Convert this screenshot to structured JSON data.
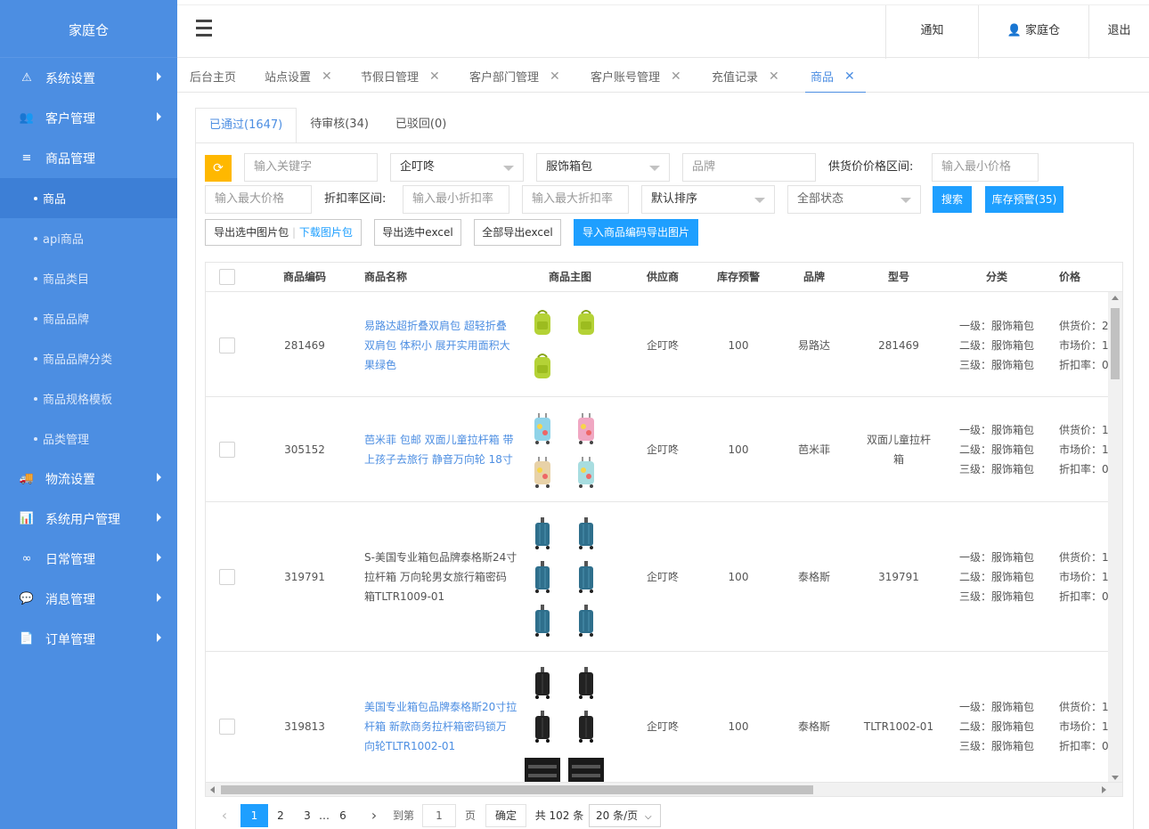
{
  "sidebar": {
    "brand": "家庭仓",
    "menu": [
      {
        "label": "系统设置",
        "icon": "warning-icon",
        "glyph": "⚠"
      },
      {
        "label": "客户管理",
        "icon": "users-icon",
        "glyph": "👥"
      },
      {
        "label": "商品管理",
        "icon": "list-icon",
        "glyph": "≡"
      },
      {
        "label": "物流设置",
        "icon": "truck-icon",
        "glyph": "🚚"
      },
      {
        "label": "系统用户管理",
        "icon": "bar-chart-icon",
        "glyph": "📊"
      },
      {
        "label": "日常管理",
        "icon": "binoculars-icon",
        "glyph": "∞"
      },
      {
        "label": "消息管理",
        "icon": "chat-icon",
        "glyph": "💬"
      },
      {
        "label": "订单管理",
        "icon": "document-icon",
        "glyph": "📄"
      }
    ],
    "submenu": [
      "商品",
      "api商品",
      "商品类目",
      "商品品牌",
      "商品品牌分类",
      "商品规格模板",
      "品类管理"
    ]
  },
  "topbar": {
    "notify": "通知",
    "user": "家庭仓",
    "logout": "退出"
  },
  "tabs": [
    "后台主页",
    "站点设置",
    "节假日管理",
    "客户部门管理",
    "客户账号管理",
    "充值记录",
    "商品"
  ],
  "subtabs": [
    "已通过(1647)",
    "待审核(34)",
    "已驳回(0)"
  ],
  "filters": {
    "keyword_placeholder": "输入关键字",
    "supplier_value": "企叮咚",
    "category_value": "服饰箱包",
    "brand_placeholder": "品牌",
    "price_range_label": "供货价价格区间:",
    "min_price_placeholder": "输入最小价格",
    "max_price_placeholder": "输入最大价格",
    "discount_label": "折扣率区间:",
    "min_discount_placeholder": "输入最小折扣率",
    "max_discount_placeholder": "输入最大折扣率",
    "sort_value": "默认排序",
    "status_value": "全部状态",
    "search_button": "搜索",
    "stock_alert_button": "库存预警(35)",
    "export_images_button": "导出选中图片包",
    "download_images_link": "下载图片包",
    "export_selected_excel": "导出选中excel",
    "export_all_excel": "全部导出excel",
    "import_codes_button": "导入商品编码导出图片"
  },
  "table": {
    "headers": [
      "商品编码",
      "商品名称",
      "商品主图",
      "供应商",
      "库存预警",
      "品牌",
      "型号",
      "分类",
      "价格"
    ],
    "rows": [
      {
        "code": "281469",
        "name": "易路达超折叠双肩包 超轻折叠双肩包 体积小 展开实用面积大 果绿色",
        "name_lines": [
          "易路达超折叠双肩包 超轻折叠",
          "双肩包 体积小 展开实用面积大",
          "果绿色"
        ],
        "supplier": "企叮咚",
        "stock_alert": "100",
        "brand": "易路达",
        "model": "281469",
        "model_lines": [
          "281469"
        ],
        "cat1": "一级：服饰箱包",
        "cat2": "二级：服饰箱包",
        "cat3": "三级：服饰箱包",
        "price1": "供货价：2",
        "price2": "市场价：1",
        "price3": "折扣率：0"
      },
      {
        "code": "305152",
        "name": "芭米菲 包邮 双面儿童拉杆箱 带上孩子去旅行 静音万向轮 18寸",
        "name_lines": [
          "芭米菲 包邮 双面儿童拉杆箱 带",
          "上孩子去旅行 静音万向轮 18寸"
        ],
        "supplier": "企叮咚",
        "stock_alert": "100",
        "brand": "芭米菲",
        "model": "双面儿童拉杆箱",
        "model_lines": [
          "双面儿童拉杆",
          "箱"
        ],
        "cat1": "一级：服饰箱包",
        "cat2": "二级：服饰箱包",
        "cat3": "三级：服饰箱包",
        "price1": "供货价：1",
        "price2": "市场价：1",
        "price3": "折扣率：0"
      },
      {
        "code": "319791",
        "name": "S-美国专业箱包品牌泰格斯24寸拉杆箱 万向轮男女旅行箱密码箱TLTR1009-01",
        "name_lines": [
          "S-美国专业箱包品牌泰格斯24寸",
          "拉杆箱 万向轮男女旅行箱密码",
          "箱TLTR1009-01"
        ],
        "supplier": "企叮咚",
        "stock_alert": "100",
        "brand": "泰格斯",
        "model": "319791",
        "model_lines": [
          "319791"
        ],
        "cat1": "一级：服饰箱包",
        "cat2": "二级：服饰箱包",
        "cat3": "三级：服饰箱包",
        "price1": "供货价：1",
        "price2": "市场价：1",
        "price3": "折扣率：0"
      },
      {
        "code": "319813",
        "name": "美国专业箱包品牌泰格斯20寸拉杆箱 新款商务拉杆箱密码锁万向轮TLTR1002-01",
        "name_lines": [
          "美国专业箱包品牌泰格斯20寸拉",
          "杆箱 新款商务拉杆箱密码锁万",
          "向轮TLTR1002-01"
        ],
        "supplier": "企叮咚",
        "stock_alert": "100",
        "brand": "泰格斯",
        "model": "TLTR1002-01",
        "model_lines": [
          "TLTR1002-01"
        ],
        "cat1": "一级：服饰箱包",
        "cat2": "二级：服饰箱包",
        "cat3": "三级：服饰箱包",
        "price1": "供货价：1",
        "price2": "市场价：1",
        "price3": "折扣率：0"
      }
    ]
  },
  "pager": {
    "pages": [
      "1",
      "2",
      "3",
      "…",
      "6"
    ],
    "goto_label": "到第",
    "goto_value": "1",
    "page_unit": "页",
    "confirm": "确定",
    "total": "共 102 条",
    "page_size": "20 条/页"
  },
  "colors": {
    "sidebar": "#4c8ee2",
    "sidebar_active": "#3d7fd6",
    "primary": "#1e9fff",
    "refresh": "#ffb800",
    "link": "#4c8ee2"
  }
}
